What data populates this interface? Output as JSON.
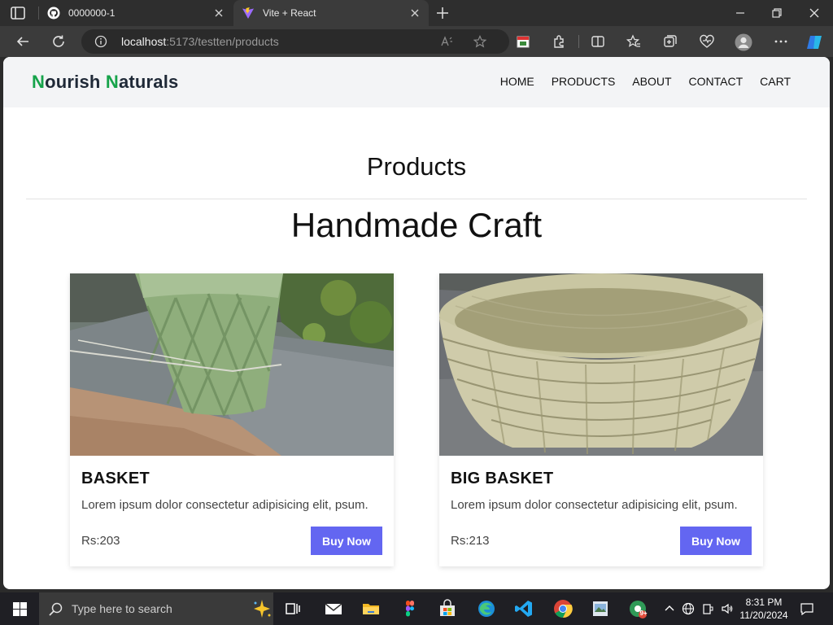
{
  "browser": {
    "tabs": [
      {
        "title": "0000000-1",
        "icon": "github-icon",
        "active": false
      },
      {
        "title": "Vite + React",
        "icon": "vite-icon",
        "active": true
      }
    ],
    "address": {
      "host": "localhost",
      "rest": ":5173/testten/products"
    }
  },
  "site": {
    "brand": {
      "first_initial": "N",
      "first_rest": "ourish ",
      "second_initial": "N",
      "second_rest": "aturals"
    },
    "nav": [
      "HOME",
      "PRODUCTS",
      "ABOUT",
      "CONTACT",
      "CART"
    ],
    "section_title": "Products",
    "category_title": "Handmade Craft",
    "products": [
      {
        "name": "BASKET",
        "description": "Lorem ipsum dolor consectetur adipisicing elit, psum.",
        "price": "Rs:203",
        "button": "Buy Now",
        "image": "woven-green-basket-photo"
      },
      {
        "name": "BIG BASKET",
        "description": "Lorem ipsum dolor consectetur adipisicing elit, psum.",
        "price": "Rs:213",
        "button": "Buy Now",
        "image": "woven-bamboo-bowl-basket-photo"
      }
    ],
    "colors": {
      "brand_accent": "#16a34a",
      "button": "#6366f1",
      "nav_bg": "#f3f4f6"
    }
  },
  "taskbar": {
    "search_placeholder": "Type here to search",
    "clock_time": "8:31 PM",
    "clock_date": "11/20/2024",
    "chrome_badge": "9+"
  }
}
